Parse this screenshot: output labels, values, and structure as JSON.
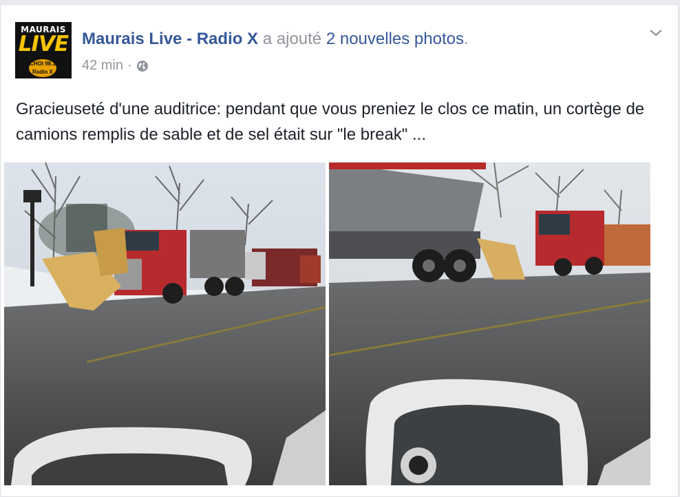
{
  "post": {
    "avatar": {
      "line1": "MAURAIS",
      "line2": "LIVE",
      "badge_line1": "CHOI 98.1",
      "badge_line2": "Radio X"
    },
    "author": "Maurais Live - Radio X",
    "action_prefix": "a ajouté",
    "action_count": "2 nouvelles photos",
    "action_suffix": ".",
    "timestamp": "42 min",
    "separator": "·",
    "privacy_icon": "globe-icon",
    "options_icon": "chevron-down-icon",
    "text": "Gracieuseté d'une auditrice: pendant que vous preniez le clos ce matin, un cortège de camions remplis de sable et de sel était sur \"le break\" ...",
    "photos": [
      {
        "description_icon": "photo-snowplow-trucks-street"
      },
      {
        "description_icon": "photo-salt-truck-mirror"
      }
    ],
    "colors": {
      "link": "#365899",
      "meta": "#90949c",
      "text": "#1d2129"
    }
  }
}
